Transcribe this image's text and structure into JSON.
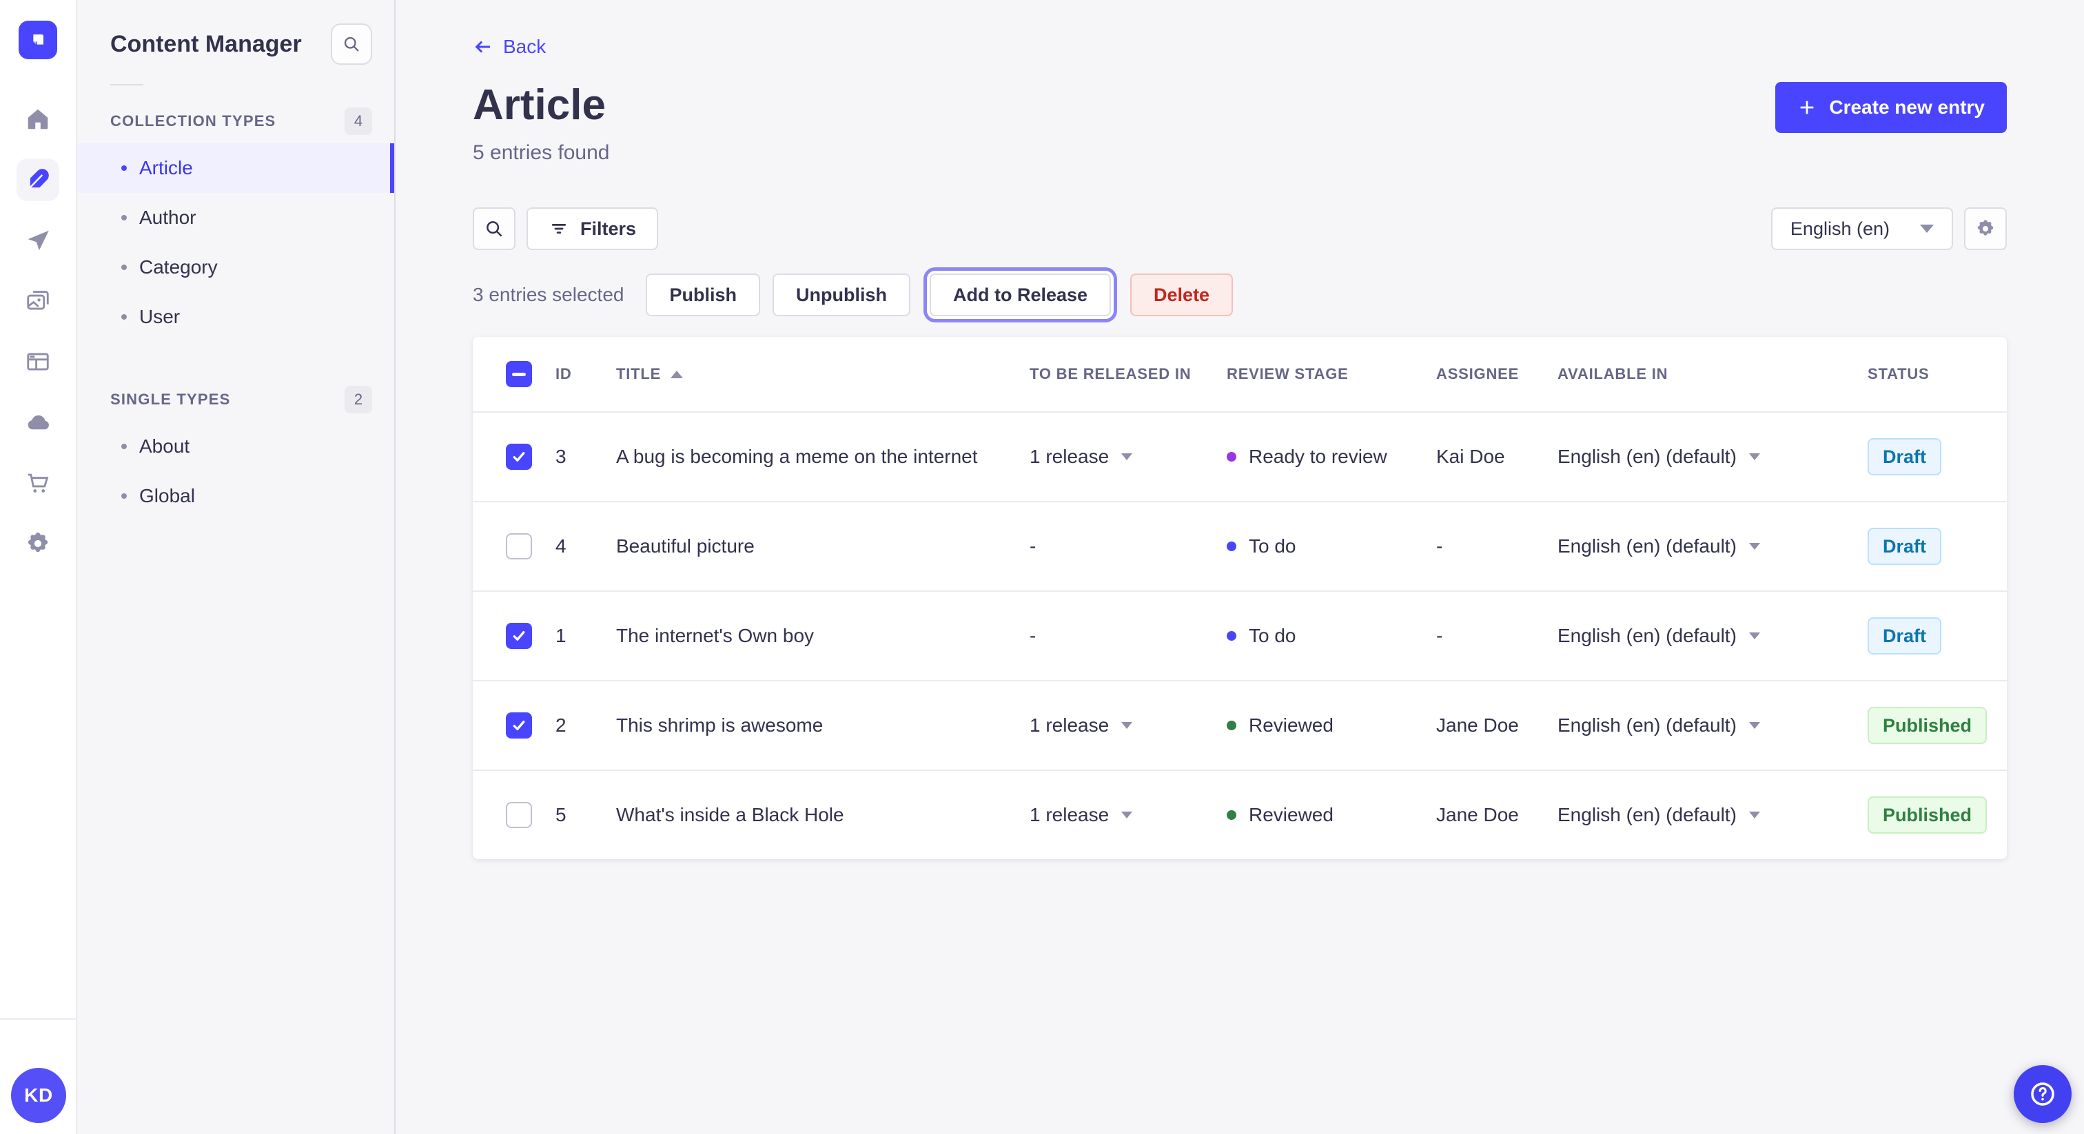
{
  "subnav": {
    "title": "Content Manager",
    "sections": [
      {
        "label": "COLLECTION TYPES",
        "badge": "4",
        "items": [
          {
            "label": "Article"
          },
          {
            "label": "Author"
          },
          {
            "label": "Category"
          },
          {
            "label": "User"
          }
        ]
      },
      {
        "label": "SINGLE TYPES",
        "badge": "2",
        "items": [
          {
            "label": "About"
          },
          {
            "label": "Global"
          }
        ]
      }
    ]
  },
  "iconbar": {
    "avatar_initials": "KD",
    "items": [
      "home-icon",
      "content-manager-icon",
      "releases-icon",
      "media-library-icon",
      "content-type-builder-icon",
      "deploy-icon",
      "marketplace-icon",
      "settings-icon"
    ]
  },
  "header": {
    "back_label": "Back",
    "title": "Article",
    "subtitle": "5 entries found",
    "create_button_label": "Create new entry"
  },
  "toolbar": {
    "filters_button_label": "Filters",
    "locale_select_value": "English (en)"
  },
  "selection_bar": {
    "summary": "3 entries selected",
    "publish_label": "Publish",
    "unpublish_label": "Unpublish",
    "add_to_release_label": "Add to Release",
    "delete_label": "Delete"
  },
  "table": {
    "select_all_state": "indeterminate",
    "sort": {
      "column": "TITLE",
      "direction": "asc"
    },
    "headers": {
      "id": "ID",
      "title": "TITLE",
      "release": "TO BE RELEASED IN",
      "review_stage": "REVIEW STAGE",
      "assignee": "ASSIGNEE",
      "available_in": "AVAILABLE IN",
      "status": "STATUS"
    },
    "rows": [
      {
        "checked": true,
        "id": "3",
        "title": "A bug is becoming a meme on the internet",
        "to_be_released_in": "1 release",
        "review_stage": "Ready to review",
        "review_stage_color": "#9736E8",
        "assignee": "Kai Doe",
        "available_in": "English (en) (default)",
        "status": "Draft",
        "status_kind": "draft"
      },
      {
        "checked": false,
        "id": "4",
        "title": "Beautiful picture",
        "to_be_released_in": "-",
        "review_stage": "To do",
        "review_stage_color": "#4945FF",
        "assignee": "-",
        "available_in": "English (en) (default)",
        "status": "Draft",
        "status_kind": "draft"
      },
      {
        "checked": true,
        "id": "1",
        "title": "The internet's Own boy",
        "to_be_released_in": "-",
        "review_stage": "To do",
        "review_stage_color": "#4945FF",
        "assignee": "-",
        "available_in": "English (en) (default)",
        "status": "Draft",
        "status_kind": "draft"
      },
      {
        "checked": true,
        "id": "2",
        "title": "This shrimp is awesome",
        "to_be_released_in": "1 release",
        "review_stage": "Reviewed",
        "review_stage_color": "#328048",
        "assignee": "Jane Doe",
        "available_in": "English (en) (default)",
        "status": "Published",
        "status_kind": "published"
      },
      {
        "checked": false,
        "id": "5",
        "title": "What's inside a Black Hole",
        "to_be_released_in": "1 release",
        "review_stage": "Reviewed",
        "review_stage_color": "#328048",
        "assignee": "Jane Doe",
        "available_in": "English (en) (default)",
        "status": "Published",
        "status_kind": "published"
      }
    ]
  },
  "colors": {
    "primary": "#4945ff",
    "draft_text": "#0c75af",
    "published_text": "#2f8040",
    "danger_text": "#c0271b",
    "stage_todo": "#4945FF",
    "stage_ready_to_review": "#9736E8",
    "stage_reviewed": "#328048"
  }
}
